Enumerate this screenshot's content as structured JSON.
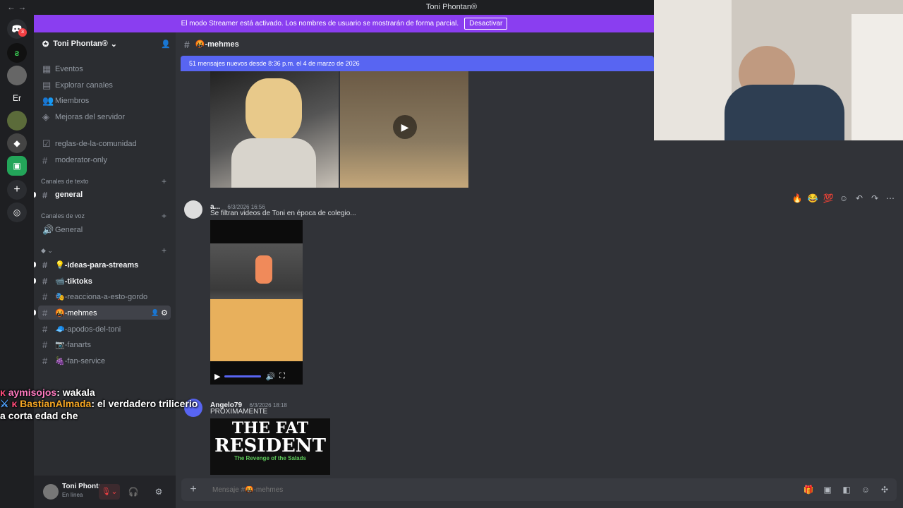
{
  "window": {
    "title": "Toni Phontan®"
  },
  "streamer_banner": {
    "text": "El modo Streamer está activado. Los nombres de usuario se mostrarán de forma parcial.",
    "button": "Desactivar"
  },
  "server": {
    "name": "Toni Phontan®",
    "badge": "3",
    "initials": "Er"
  },
  "sidebar": {
    "top_items": [
      "Eventos",
      "Explorar canales",
      "Miembros",
      "Mejoras del servidor"
    ],
    "static_channels": [
      "reglas-de-la-comunidad",
      "moderator-only"
    ],
    "text_category": "Canales de texto",
    "text_channels": [
      "general"
    ],
    "voice_category": "Canales de voz",
    "voice_channels": [
      "General"
    ],
    "custom_channels": [
      "💡-ideas-para-streams",
      "📹-tiktoks",
      "🎭-reacciona-a-esto-gordo",
      "🤬-mehmes",
      "🧢-apodos-del-toni",
      "📷-fanarts",
      "🍇-fan-service"
    ]
  },
  "user": {
    "name": "Toni Phontana",
    "status": "En línea"
  },
  "channel": {
    "name": "🤬-mehmes"
  },
  "new_messages_bar": "51 mensajes nuevos desde 8:36 p.m. el 4 de marzo de 2026",
  "messages": [
    {
      "author": "a...",
      "time": "6/3/2026 16:56",
      "text": "Se filtran videos de Toni en época de colegio..."
    },
    {
      "author": "Angelo79",
      "time": "6/3/2026 18:18",
      "text": "PROXIMAMENTE"
    }
  ],
  "poster": {
    "title1": "THE FAT",
    "title2": "RESIDENT",
    "subtitle": "The Revenge of the Salads"
  },
  "composer": {
    "placeholder": "Mensaje #🤬-mehmes"
  },
  "stream_chat": [
    {
      "user": "aymisojos",
      "text": "wakala"
    },
    {
      "user": "BastianAlmada",
      "text": "el verdadero trilicerio"
    },
    {
      "user": "",
      "text": "a corta edad che"
    }
  ],
  "colors": {
    "accent": "#5865f2",
    "streamer": "#8a3ef0",
    "bg": "#313338"
  }
}
